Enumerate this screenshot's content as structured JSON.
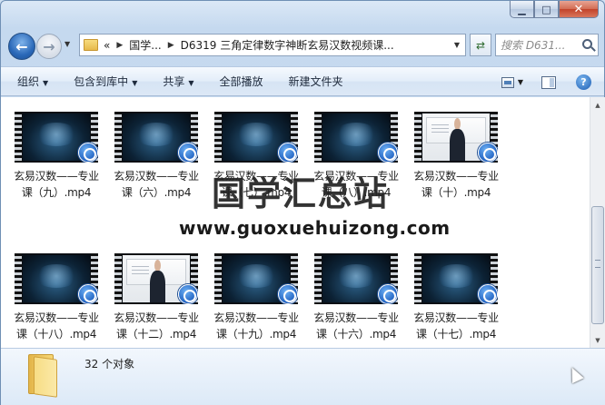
{
  "window": {
    "caption": {
      "minimize": "▁",
      "maximize": "□",
      "close": "✕"
    }
  },
  "nav": {
    "back_icon": "back-arrow-icon",
    "forward_icon": "forward-arrow-icon",
    "address": {
      "overflow": "«",
      "crumb1": "国学...",
      "crumb2": "D6319 三角定律数字神断玄易汉数视频课..."
    },
    "search_placeholder": "搜索 D631..."
  },
  "toolbar": {
    "organize": "组织",
    "include_library": "包含到库中",
    "share": "共享",
    "play_all": "全部播放",
    "new_folder": "新建文件夹"
  },
  "files": [
    {
      "line1": "玄易汉数——专业",
      "line2": "课（九）.mp4",
      "thumb": "cover"
    },
    {
      "line1": "玄易汉数——专业",
      "line2": "课（六）.mp4",
      "thumb": "cover"
    },
    {
      "line1": "玄易汉数——专业",
      "line2": "课（七）.mp4",
      "thumb": "cover"
    },
    {
      "line1": "玄易汉数——专业",
      "line2": "课（八）.mp4",
      "thumb": "cover"
    },
    {
      "line1": "玄易汉数——专业",
      "line2": "课（十）.mp4",
      "thumb": "lecture"
    },
    {
      "line1": "玄易汉数——专业",
      "line2": "课（十八）.mp4",
      "thumb": "cover"
    },
    {
      "line1": "玄易汉数——专业",
      "line2": "课（十二）.mp4",
      "thumb": "lecture"
    },
    {
      "line1": "玄易汉数——专业",
      "line2": "课（十九）.mp4",
      "thumb": "cover"
    },
    {
      "line1": "玄易汉数——专业",
      "line2": "课（十六）.mp4",
      "thumb": "cover"
    },
    {
      "line1": "玄易汉数——专业",
      "line2": "课（十七）.mp4",
      "thumb": "cover"
    }
  ],
  "watermark": {
    "title": "国学汇总站",
    "url": "www.guoxuehuizong.com"
  },
  "details": {
    "count": "32 个对象"
  }
}
